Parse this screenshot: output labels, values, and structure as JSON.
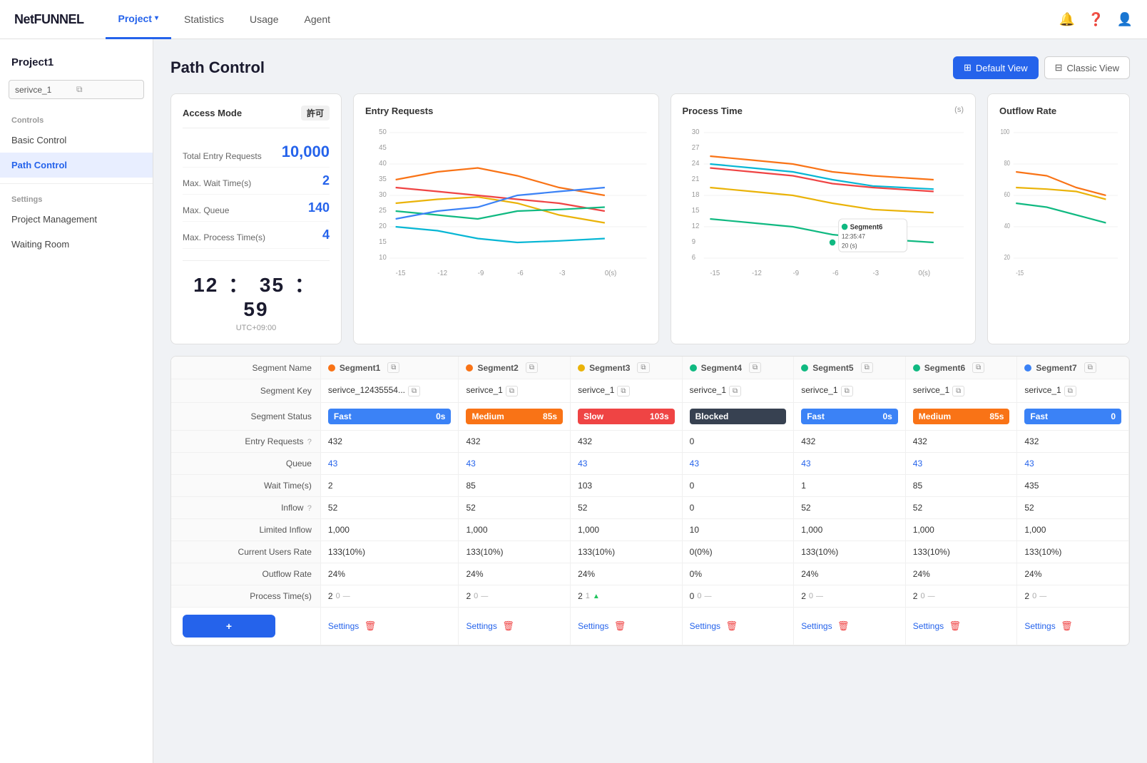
{
  "app": {
    "logo": "NetFUNNEL"
  },
  "nav": {
    "items": [
      {
        "label": "Project",
        "hasDropdown": true,
        "active": true
      },
      {
        "label": "Statistics",
        "active": false
      },
      {
        "label": "Usage",
        "active": false
      },
      {
        "label": "Agent",
        "active": false
      }
    ]
  },
  "sidebar": {
    "project": "Project1",
    "service_key": "serivce_1",
    "controls_label": "Controls",
    "settings_label": "Settings",
    "items_controls": [
      {
        "label": "Basic Control",
        "active": false
      },
      {
        "label": "Path Control",
        "active": true
      }
    ],
    "items_settings": [
      {
        "label": "Project Management",
        "active": false
      },
      {
        "label": "Waiting Room",
        "active": false
      }
    ]
  },
  "page": {
    "title": "Path Control",
    "view_default": "Default View",
    "view_classic": "Classic View"
  },
  "access_card": {
    "mode_label": "Access Mode",
    "mode_value": "許可",
    "stats": [
      {
        "label": "Total Entry Requests",
        "value": "10,000"
      },
      {
        "label": "Max. Wait Time(s)",
        "value": "2"
      },
      {
        "label": "Max. Queue",
        "value": "140"
      },
      {
        "label": "Max. Process Time(s)",
        "value": "4"
      }
    ],
    "clock": {
      "h": "12",
      "m": "35",
      "s": "59",
      "timezone": "UTC+09:00"
    }
  },
  "charts": {
    "entry_requests": {
      "title": "Entry Requests",
      "unit": ""
    },
    "process_time": {
      "title": "Process Time",
      "unit": "(s)"
    },
    "outflow_rate": {
      "title": "Outflow Rate",
      "unit": ""
    }
  },
  "segments": [
    {
      "name": "Segment1",
      "color": "#f97316",
      "key": "serivce_12435554...",
      "status": "Fast",
      "status_time": "0s",
      "status_class": "status-fast",
      "entry_requests": "432",
      "queue": "43",
      "wait_time": "2",
      "inflow": "52",
      "limited_inflow": "1,000",
      "current_users": "133(10%)",
      "outflow_rate": "24%",
      "process_time": "2",
      "process_delta": "0",
      "process_trend": "neutral"
    },
    {
      "name": "Segment2",
      "color": "#f97316",
      "key": "serivce_1",
      "status": "Medium",
      "status_time": "85s",
      "status_class": "status-medium",
      "entry_requests": "432",
      "queue": "43",
      "wait_time": "85",
      "inflow": "52",
      "limited_inflow": "1,000",
      "current_users": "133(10%)",
      "outflow_rate": "24%",
      "process_time": "2",
      "process_delta": "0",
      "process_trend": "neutral"
    },
    {
      "name": "Segment3",
      "color": "#eab308",
      "key": "serivce_1",
      "status": "Slow",
      "status_time": "103s",
      "status_class": "status-slow",
      "entry_requests": "432",
      "queue": "43",
      "wait_time": "103",
      "inflow": "52",
      "limited_inflow": "1,000",
      "current_users": "133(10%)",
      "outflow_rate": "24%",
      "process_time": "2",
      "process_delta": "1",
      "process_trend": "up"
    },
    {
      "name": "Segment4",
      "color": "#10b981",
      "key": "serivce_1",
      "status": "Blocked",
      "status_time": "",
      "status_class": "status-blocked",
      "entry_requests": "0",
      "queue": "43",
      "wait_time": "0",
      "inflow": "0",
      "limited_inflow": "10",
      "current_users": "0(0%)",
      "outflow_rate": "0%",
      "process_time": "0",
      "process_delta": "0",
      "process_trend": "neutral"
    },
    {
      "name": "Segment5",
      "color": "#10b981",
      "key": "serivce_1",
      "status": "Fast",
      "status_time": "0s",
      "status_class": "status-fast",
      "entry_requests": "432",
      "queue": "43",
      "wait_time": "1",
      "inflow": "52",
      "limited_inflow": "1,000",
      "current_users": "133(10%)",
      "outflow_rate": "24%",
      "process_time": "2",
      "process_delta": "0",
      "process_trend": "neutral"
    },
    {
      "name": "Segment6",
      "color": "#10b981",
      "key": "serivce_1",
      "status": "Medium",
      "status_time": "85s",
      "status_class": "status-medium",
      "entry_requests": "432",
      "queue": "43",
      "wait_time": "85",
      "inflow": "52",
      "limited_inflow": "1,000",
      "current_users": "133(10%)",
      "outflow_rate": "24%",
      "process_time": "2",
      "process_delta": "0",
      "process_trend": "neutral"
    },
    {
      "name": "Segment7",
      "color": "#3b82f6",
      "key": "serivce_1",
      "status": "Fast",
      "status_time": "0s",
      "status_class": "status-fast",
      "entry_requests": "432",
      "queue": "43",
      "wait_time": "435",
      "inflow": "52",
      "limited_inflow": "1,000",
      "current_users": "133(10%)",
      "outflow_rate": "24%",
      "process_time": "2",
      "process_delta": "0",
      "process_trend": "neutral"
    }
  ],
  "table_rows": [
    "Segment Name",
    "Segment Key",
    "Segment Status",
    "Entry Requests",
    "Queue",
    "Wait Time(s)",
    "Inflow",
    "Limited Inflow",
    "Current Users Rate",
    "Outflow Rate",
    "Process Time(s)"
  ],
  "add_button": "+",
  "settings_label": "Settings"
}
